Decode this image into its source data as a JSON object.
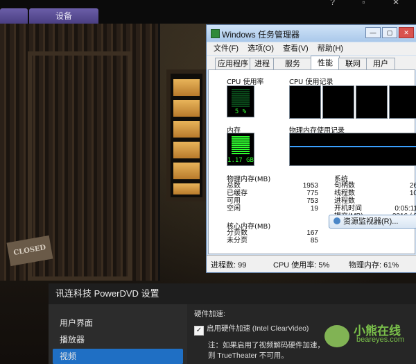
{
  "top": {
    "tab1": "",
    "tab2": "设备",
    "window_icons": "? ▫ ✕"
  },
  "scene": {
    "sign_text": "CLOSED"
  },
  "task_manager": {
    "title": "Windows 任务管理器",
    "controls": {
      "min": "—",
      "max": "▢",
      "close": "✕"
    },
    "menus": [
      "文件(F)",
      "选项(O)",
      "查看(V)",
      "帮助(H)"
    ],
    "tabs": [
      "应用程序",
      "进程",
      "服务",
      "性能",
      "联网",
      "用户"
    ],
    "active_tab": "性能",
    "cpu_usage_label": "CPU 使用率",
    "cpu_usage_value": "5 %",
    "cpu_history_label": "CPU 使用记录",
    "memory_label": "内存",
    "memory_value": "1.17 GB",
    "mem_history_label": "物理内存使用记录",
    "physical_mem": {
      "title": "物理内存(MB)",
      "rows": [
        [
          "总数",
          "1953"
        ],
        [
          "已缓存",
          "775"
        ],
        [
          "可用",
          "753"
        ],
        [
          "空闲",
          "19"
        ]
      ]
    },
    "kernel_mem": {
      "title": "核心内存(MB)",
      "rows": [
        [
          "分页数",
          "167"
        ],
        [
          "未分页",
          "85"
        ]
      ]
    },
    "system": {
      "title": "系统",
      "rows": [
        [
          "句柄数",
          "26"
        ],
        [
          "线程数",
          "10"
        ],
        [
          "进程数",
          ""
        ],
        [
          "开机时间",
          "0:05:11"
        ],
        [
          "提交(MB)",
          "2216 / 3"
        ]
      ]
    },
    "resource_monitor_button": "资源监视器(R)...",
    "status": {
      "processes": "进程数: 99",
      "cpu": "CPU 使用率: 5%",
      "memory": "物理内存: 61%"
    }
  },
  "powerdvd": {
    "title": "讯连科技 PowerDVD 设置",
    "nav": [
      "用户界面",
      "播放器",
      "视频"
    ],
    "selected_nav": "视频",
    "section": "硬件加速:",
    "checkbox_label": "启用硬件加速 (Intel ClearVideo)",
    "checkbox_checked": true,
    "note1": "注：如果启用了视频解码硬件加速，",
    "note2": "则 TrueTheater 不可用。"
  },
  "watermark": {
    "text1": "小熊在线",
    "text2": "beareyes.com"
  }
}
